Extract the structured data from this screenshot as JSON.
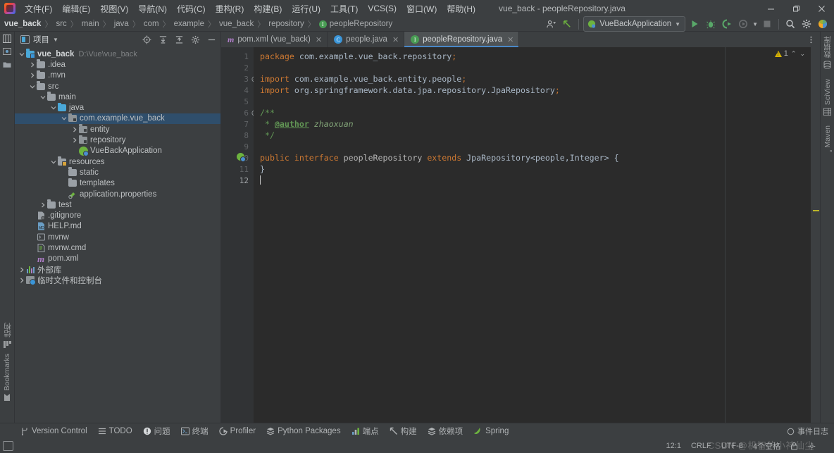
{
  "window": {
    "title": "vue_back - peopleRepository.java",
    "app_icon": "intellij-idea-logo",
    "controls": {
      "minimize": "—",
      "maximize": "❐",
      "close": "✕"
    }
  },
  "menubar": {
    "items": [
      {
        "label": "文件(F)"
      },
      {
        "label": "编辑(E)"
      },
      {
        "label": "视图(V)"
      },
      {
        "label": "导航(N)"
      },
      {
        "label": "代码(C)"
      },
      {
        "label": "重构(R)"
      },
      {
        "label": "构建(B)"
      },
      {
        "label": "运行(U)"
      },
      {
        "label": "工具(T)"
      },
      {
        "label": "VCS(S)"
      },
      {
        "label": "窗口(W)"
      },
      {
        "label": "帮助(H)"
      }
    ]
  },
  "breadcrumb": {
    "separator": "〉",
    "items": [
      {
        "label": "vue_back",
        "bold": true
      },
      {
        "label": "src"
      },
      {
        "label": "main"
      },
      {
        "label": "java"
      },
      {
        "label": "com"
      },
      {
        "label": "example"
      },
      {
        "label": "vue_back"
      },
      {
        "label": "repository"
      },
      {
        "label": "peopleRepository",
        "icon": "interface-badge"
      }
    ]
  },
  "toolbar": {
    "settings_sync_label": "settings-sync",
    "back_label": "back",
    "run_config": "VueBackApplication",
    "run_label": "Run",
    "debug_label": "Debug",
    "run_coverage_label": "Run with Coverage",
    "profile_label": "Profile",
    "stop_label": "Stop",
    "search_label": "Search Everywhere",
    "settings_label": "Settings",
    "ide_label": "IDE Features"
  },
  "project_panel": {
    "title": "项目",
    "header_buttons": [
      {
        "name": "locate-icon"
      },
      {
        "name": "expand-all-icon"
      },
      {
        "name": "collapse-all-icon"
      },
      {
        "name": "settings-gear-icon"
      },
      {
        "name": "hide-icon"
      }
    ],
    "tree": [
      {
        "indent": 0,
        "arrow": "v",
        "icon": "project-folder",
        "label": "vue_back",
        "bold": true,
        "sub": "D:\\Vue\\vue_back"
      },
      {
        "indent": 1,
        "arrow": ">",
        "icon": "folder",
        "label": ".idea"
      },
      {
        "indent": 1,
        "arrow": ">",
        "icon": "folder",
        "label": ".mvn"
      },
      {
        "indent": 1,
        "arrow": "v",
        "icon": "folder",
        "label": "src"
      },
      {
        "indent": 2,
        "arrow": "v",
        "icon": "folder",
        "label": "main"
      },
      {
        "indent": 3,
        "arrow": "v",
        "icon": "source-folder",
        "label": "java"
      },
      {
        "indent": 4,
        "arrow": "v",
        "icon": "package",
        "label": "com.example.vue_back",
        "selected": true
      },
      {
        "indent": 5,
        "arrow": ">",
        "icon": "package",
        "label": "entity"
      },
      {
        "indent": 5,
        "arrow": ">",
        "icon": "package",
        "label": "repository"
      },
      {
        "indent": 5,
        "arrow": "",
        "icon": "spring-class",
        "label": "VueBackApplication"
      },
      {
        "indent": 3,
        "arrow": "v",
        "icon": "resource-folder",
        "label": "resources"
      },
      {
        "indent": 4,
        "arrow": "",
        "icon": "folder",
        "label": "static"
      },
      {
        "indent": 4,
        "arrow": "",
        "icon": "folder",
        "label": "templates"
      },
      {
        "indent": 4,
        "arrow": "",
        "icon": "properties-file",
        "label": "application.properties"
      },
      {
        "indent": 2,
        "arrow": ">",
        "icon": "test-folder",
        "label": "test"
      },
      {
        "indent": 1,
        "arrow": "",
        "icon": "gitignore-file",
        "label": ".gitignore"
      },
      {
        "indent": 1,
        "arrow": "",
        "icon": "markdown-file",
        "label": "HELP.md"
      },
      {
        "indent": 1,
        "arrow": "",
        "icon": "shell-file",
        "label": "mvnw"
      },
      {
        "indent": 1,
        "arrow": "",
        "icon": "cmd-file",
        "label": "mvnw.cmd"
      },
      {
        "indent": 1,
        "arrow": "",
        "icon": "maven-file",
        "label": "pom.xml"
      },
      {
        "indent": 0,
        "arrow": ">",
        "icon": "external-libraries",
        "label": "外部库"
      },
      {
        "indent": 0,
        "arrow": ">",
        "icon": "scratches",
        "label": "临时文件和控制台"
      }
    ]
  },
  "left_strip": {
    "top_icons": [
      {
        "name": "project-icon"
      },
      {
        "name": "commit-icon"
      },
      {
        "name": "folder-icon"
      }
    ],
    "bottom_items": [
      {
        "label": "结构",
        "icon": "structure-icon"
      },
      {
        "label": "Bookmarks",
        "icon": "bookmark-icon"
      }
    ]
  },
  "right_strip": {
    "items": [
      {
        "label": "数据库",
        "icon": "database-icon"
      },
      {
        "label": "SciView",
        "icon": "sciview-icon"
      },
      {
        "label": "Maven",
        "icon": "maven-icon"
      }
    ]
  },
  "editor_tabs": [
    {
      "label": "pom.xml (vue_back)",
      "icon": "maven-badge",
      "active": false,
      "close": "✕"
    },
    {
      "label": "people.java",
      "icon": "class-badge",
      "active": false,
      "close": "✕"
    },
    {
      "label": "peopleRepository.java",
      "icon": "interface-badge",
      "active": true,
      "close": "✕"
    }
  ],
  "inspection": {
    "warning_count": "1",
    "up_chevron": "⌃",
    "down_chevron": "⌄"
  },
  "code": {
    "filename": "peopleRepository.java",
    "lines": [
      {
        "no": "1",
        "fold": "",
        "tokens": [
          {
            "t": "kw",
            "v": "package"
          },
          {
            "t": "ident",
            "v": " com.example.vue_back.repository"
          },
          {
            "t": "semi",
            "v": ";"
          }
        ]
      },
      {
        "no": "2",
        "fold": "",
        "tokens": []
      },
      {
        "no": "3",
        "fold": "⊖",
        "tokens": [
          {
            "t": "kw",
            "v": "import"
          },
          {
            "t": "ident",
            "v": " com.example.vue_back.entity.people"
          },
          {
            "t": "semi",
            "v": ";"
          }
        ]
      },
      {
        "no": "4",
        "fold": "└",
        "tokens": [
          {
            "t": "kw",
            "v": "import"
          },
          {
            "t": "ident",
            "v": " org.springframework.data.jpa.repository.JpaRepository"
          },
          {
            "t": "semi",
            "v": ";"
          }
        ]
      },
      {
        "no": "5",
        "fold": "",
        "tokens": []
      },
      {
        "no": "6",
        "fold": "⊖",
        "tokens": [
          {
            "t": "doc",
            "v": "/**"
          }
        ]
      },
      {
        "no": "7",
        "fold": "",
        "tokens": [
          {
            "t": "doc",
            "v": " * "
          },
          {
            "t": "doctag",
            "v": "@author"
          },
          {
            "t": "docit",
            "v": " zhaoxuan"
          }
        ]
      },
      {
        "no": "8",
        "fold": "└",
        "tokens": [
          {
            "t": "doc",
            "v": " */"
          }
        ]
      },
      {
        "no": "9",
        "fold": "",
        "tokens": []
      },
      {
        "no": "10",
        "fold": "",
        "gutter_icon": "spring-bean-icon",
        "tokens": [
          {
            "t": "kw",
            "v": "public interface"
          },
          {
            "t": "ifacename",
            "v": " peopleRepository "
          },
          {
            "t": "kw",
            "v": "extends"
          },
          {
            "t": "ident",
            "v": " JpaRepository<people,Integer> {"
          }
        ]
      },
      {
        "no": "11",
        "fold": "",
        "tokens": [
          {
            "t": "ident",
            "v": "}"
          }
        ]
      },
      {
        "no": "12",
        "fold": "",
        "cursor": true,
        "tokens": []
      }
    ]
  },
  "bottom_bar": {
    "items": [
      {
        "label": "Version Control",
        "icon": "branch-icon"
      },
      {
        "label": "TODO",
        "icon": "todo-icon"
      },
      {
        "label": "问题",
        "icon": "problems-icon"
      },
      {
        "label": "终端",
        "icon": "terminal-icon"
      },
      {
        "label": "Profiler",
        "icon": "profiler-icon"
      },
      {
        "label": "Python Packages",
        "icon": "packages-icon"
      },
      {
        "label": "端点",
        "icon": "endpoints-icon"
      },
      {
        "label": "构建",
        "icon": "build-icon"
      },
      {
        "label": "依赖项",
        "icon": "dependencies-icon"
      },
      {
        "label": "Spring",
        "icon": "spring-icon"
      }
    ],
    "event_log": "事件日志"
  },
  "status_bar": {
    "caret_position": "12:1",
    "line_separator": "CRLF",
    "encoding": "UTF-8",
    "indent": "4个空格",
    "watermark": "CSDN @机智的小神仙尘"
  }
}
